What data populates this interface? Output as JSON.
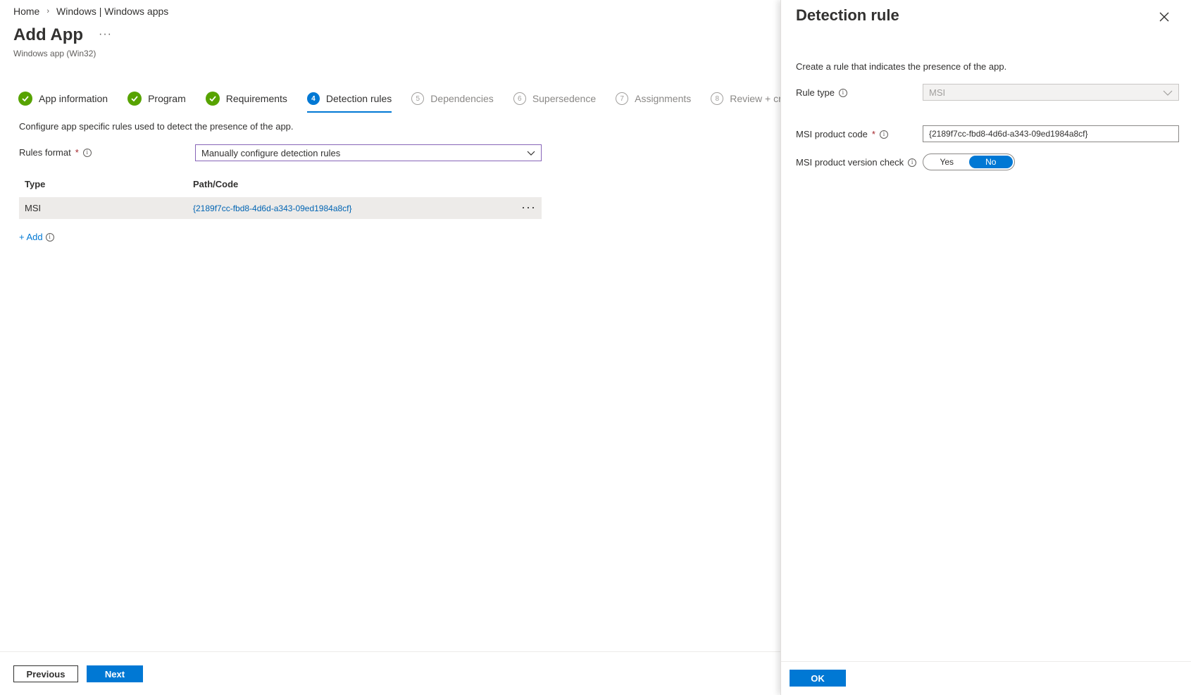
{
  "breadcrumb": {
    "home": "Home",
    "separator": "›",
    "section": "Windows | Windows apps"
  },
  "page": {
    "title": "Add App",
    "more": "···",
    "subtitle": "Windows app (Win32)"
  },
  "wizard": {
    "steps": [
      {
        "label": "App information",
        "state": "completed"
      },
      {
        "label": "Program",
        "state": "completed"
      },
      {
        "label": "Requirements",
        "state": "completed"
      },
      {
        "number": "4",
        "label": "Detection rules",
        "state": "active"
      },
      {
        "number": "5",
        "label": "Dependencies",
        "state": "pending"
      },
      {
        "number": "6",
        "label": "Supersedence",
        "state": "pending"
      },
      {
        "number": "7",
        "label": "Assignments",
        "state": "pending"
      },
      {
        "number": "8",
        "label": "Review + create",
        "state": "pending"
      }
    ]
  },
  "detection": {
    "description": "Configure app specific rules used to detect the presence of the app.",
    "rules_format_label": "Rules format",
    "required_marker": "*",
    "info_glyph": "i",
    "rules_format_value": "Manually configure detection rules",
    "table": {
      "headers": [
        "Type",
        "Path/Code"
      ],
      "rows": [
        {
          "type": "MSI",
          "path": "{2189f7cc-fbd8-4d6d-a343-09ed1984a8cf}",
          "more": "···"
        }
      ]
    },
    "add_label": "+ Add"
  },
  "footer": {
    "previous_label": "Previous",
    "next_label": "Next"
  },
  "blade": {
    "title": "Detection rule",
    "description": "Create a rule that indicates the presence of the app.",
    "rule_type_label": "Rule type",
    "rule_type_value": "MSI",
    "product_code_label": "MSI product code",
    "product_code_value": "{2189f7cc-fbd8-4d6d-a343-09ed1984a8cf}",
    "version_check_label": "MSI product version check",
    "toggle_yes": "Yes",
    "toggle_no": "No",
    "toggle_selected": "No",
    "ok_label": "OK"
  },
  "colors": {
    "accent": "#0078d4",
    "success": "#57a300",
    "required": "#a4262c",
    "focus_border": "#8764b8"
  },
  "icons": [
    "checkmark-circle-icon",
    "info-icon",
    "chevron-down-icon",
    "close-icon",
    "more-icon"
  ]
}
